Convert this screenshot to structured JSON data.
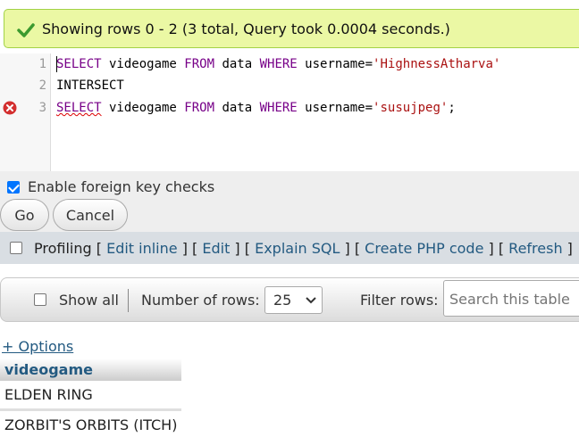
{
  "success_message": "Showing rows 0 - 2 (3 total, Query took 0.0004 seconds.)",
  "editor": {
    "line_numbers": [
      "1",
      "2",
      "3"
    ],
    "line1": {
      "kw1": "SELECT",
      "t1": " videogame ",
      "kw2": "FROM",
      "t2": " data ",
      "kw3": "WHERE",
      "t3": " username=",
      "str": "'HighnessAtharva'"
    },
    "line2": {
      "text": "INTERSECT"
    },
    "line3": {
      "kw1": "SELECT",
      "t1": " videogame ",
      "kw2": "FROM",
      "t2": " data ",
      "kw3": "WHERE",
      "t3": " username=",
      "str": "'susujpeg'",
      "end": ";"
    }
  },
  "options": {
    "foreign_key_label": "Enable foreign key checks",
    "foreign_key_checked": true,
    "go_label": "Go",
    "cancel_label": "Cancel"
  },
  "profiling": {
    "label": "Profiling",
    "links": [
      "Edit inline",
      "Edit",
      "Explain SQL",
      "Create PHP code",
      "Refresh"
    ]
  },
  "navigation": {
    "show_all_label": "Show all",
    "number_of_rows_label": "Number of rows:",
    "rows_value": "25",
    "filter_label": "Filter rows:",
    "search_placeholder": "Search this table"
  },
  "results": {
    "options_link": "+ Options",
    "column_header": "videogame",
    "rows": [
      "ELDEN RING",
      "ZORBIT'S ORBITS (ITCH)"
    ]
  },
  "colors": {
    "success_bg": "#ebf8a4",
    "link": "#235a81",
    "error_icon": "#d32f2f"
  }
}
